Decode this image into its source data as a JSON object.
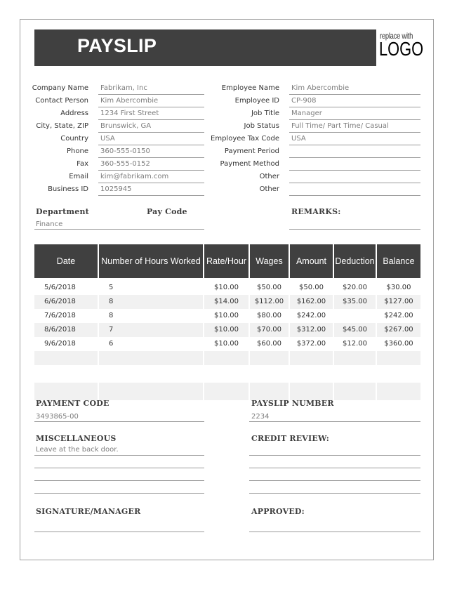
{
  "header": {
    "title": "PAYSLIP",
    "logo_small": "replace with",
    "logo_big": "LOGO"
  },
  "company": [
    {
      "label": "Company Name",
      "value": "Fabrikam, Inc"
    },
    {
      "label": "Contact Person",
      "value": "Kim Abercombie"
    },
    {
      "label": "Address",
      "value": "1234 First Street"
    },
    {
      "label": "City, State, ZIP",
      "value": "Brunswick, GA"
    },
    {
      "label": "Country",
      "value": "USA"
    },
    {
      "label": "Phone",
      "value": "360-555-0150"
    },
    {
      "label": "Fax",
      "value": "360-555-0152"
    },
    {
      "label": "Email",
      "value": "kim@fabrikam.com"
    },
    {
      "label": "Business ID",
      "value": "1025945"
    }
  ],
  "employee": [
    {
      "label": "Employee Name",
      "value": "Kim Abercombie"
    },
    {
      "label": "Employee ID",
      "value": "CP-908"
    },
    {
      "label": "Job Title",
      "value": "Manager"
    },
    {
      "label": "Job Status",
      "value": "Full Time/ Part Time/ Casual"
    },
    {
      "label": "Employee Tax Code",
      "value": "USA"
    },
    {
      "label": "Payment Period",
      "value": ""
    },
    {
      "label": "Payment Method",
      "value": ""
    },
    {
      "label": "Other",
      "value": ""
    },
    {
      "label": "Other",
      "value": ""
    }
  ],
  "department": {
    "label": "Department",
    "value": "Finance",
    "pay_code_label": "Pay Code",
    "remarks_label": "REMARKS:"
  },
  "table": {
    "headers": [
      "Date",
      "Number of Hours Worked",
      "Rate/Hour",
      "Wages",
      "Amount",
      "Deduction",
      "Balance"
    ],
    "rows": [
      [
        "5/6/2018",
        "5",
        "$10.00",
        "$50.00",
        "$50.00",
        "$20.00",
        "$30.00"
      ],
      [
        "6/6/2018",
        "8",
        "$14.00",
        "$112.00",
        "$162.00",
        "$35.00",
        "$127.00"
      ],
      [
        "7/6/2018",
        "8",
        "$10.00",
        "$80.00",
        "$242.00",
        "",
        "$242.00"
      ],
      [
        "8/6/2018",
        "7",
        "$10.00",
        "$70.00",
        "$312.00",
        "$45.00",
        "$267.00"
      ],
      [
        "9/6/2018",
        "6",
        "$10.00",
        "$60.00",
        "$372.00",
        "$12.00",
        "$360.00"
      ]
    ]
  },
  "footer": {
    "payment_code_label": "PAYMENT CODE",
    "payment_code": "3493865-00",
    "payslip_number_label": "PAYSLIP NUMBER",
    "payslip_number": "2234",
    "misc_label": "MISCELLANEOUS",
    "misc_value": "Leave at the back door.",
    "credit_review_label": "CREDIT REVIEW:",
    "signature_label": "SIGNATURE/MANAGER",
    "approved_label": "APPROVED:"
  },
  "colors": {
    "header_bg": "#404040",
    "row_alt": "#f1f1f1"
  }
}
